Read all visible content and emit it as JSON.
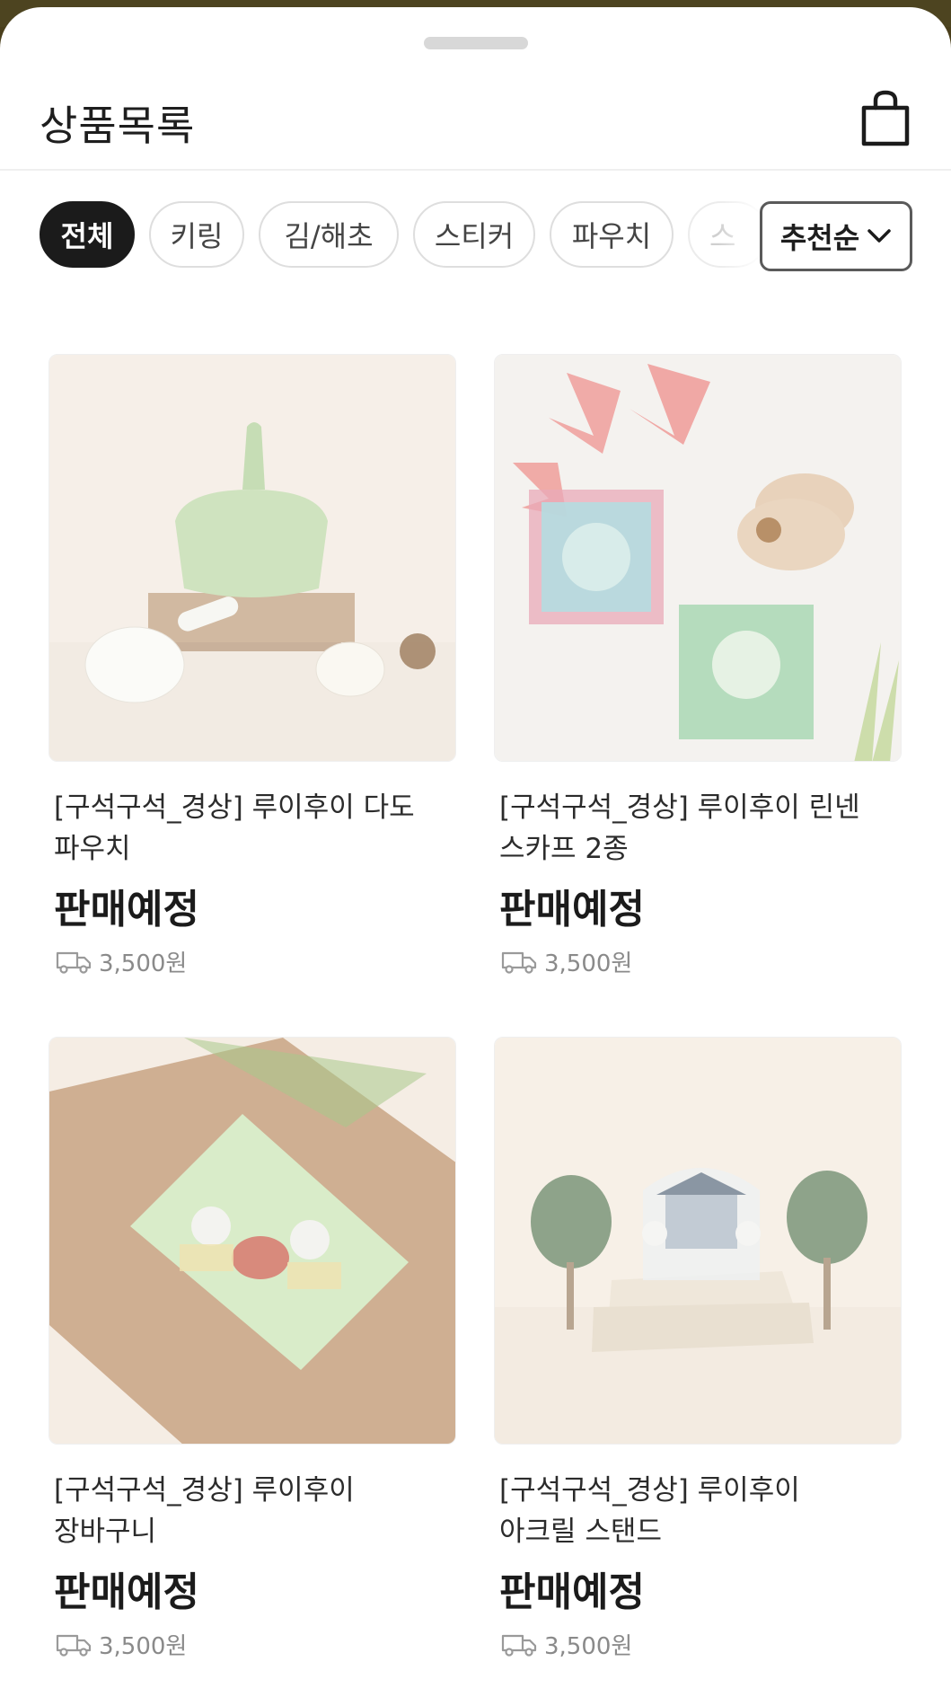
{
  "header": {
    "title": "상품목록",
    "cart_icon": "shopping-bag-icon"
  },
  "filters": {
    "categories": [
      {
        "label": "전체",
        "active": true
      },
      {
        "label": "키링",
        "active": false
      },
      {
        "label": "김/해초",
        "active": false
      },
      {
        "label": "스티커",
        "active": false
      },
      {
        "label": "파우치",
        "active": false
      },
      {
        "label": "스",
        "active": false
      }
    ],
    "sort_label": "추천순",
    "sort_icon": "chevron-down-icon"
  },
  "products": [
    {
      "name": "[구석구석_경상] 루이후이 다도 파우치",
      "status": "판매예정",
      "shipping_fee": "3,500원",
      "shipping_icon": "truck-icon"
    },
    {
      "name": "[구석구석_경상] 루이후이 린넨 스카프 2종",
      "status": "판매예정",
      "shipping_fee": "3,500원",
      "shipping_icon": "truck-icon"
    },
    {
      "name": "[구석구석_경상] 루이후이 장바구니",
      "status": "판매예정",
      "shipping_fee": "3,500원",
      "shipping_icon": "truck-icon"
    },
    {
      "name": "[구석구석_경상] 루이후이 아크릴 스탠드",
      "status": "판매예정",
      "shipping_fee": "3,500원",
      "shipping_icon": "truck-icon"
    }
  ],
  "colors": {
    "active_chip": "#1b1b1b",
    "text_primary": "#1e1e1e",
    "text_muted": "#8a8a8a"
  }
}
